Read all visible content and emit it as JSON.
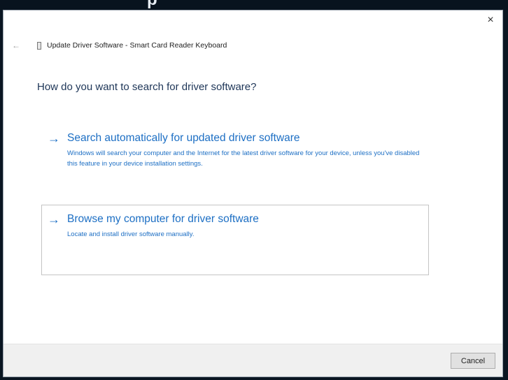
{
  "window": {
    "banner_text": "p                                   ",
    "close_glyph": "×",
    "back_glyph": "←",
    "title": "Update Driver Software - Smart Card Reader Keyboard"
  },
  "content": {
    "question": "How do you want to search for driver software?",
    "options": [
      {
        "arrow": "→",
        "title": "Search automatically for updated driver software",
        "description": "Windows will search your computer and the Internet for the latest driver software for your device, unless you've disabled this feature in your device installation settings."
      },
      {
        "arrow": "→",
        "title": "Browse my computer for driver software",
        "description": "Locate and install driver software manually."
      }
    ]
  },
  "footer": {
    "cancel_label": "Cancel"
  },
  "colors": {
    "link_blue": "#1d6fc4",
    "question_navy": "#1d3557",
    "footer_gray": "#f0f0f0"
  },
  "icons": {
    "close": "close-icon",
    "back": "back-arrow-icon",
    "device": "device-icon",
    "option_arrow": "arrow-right-icon"
  }
}
